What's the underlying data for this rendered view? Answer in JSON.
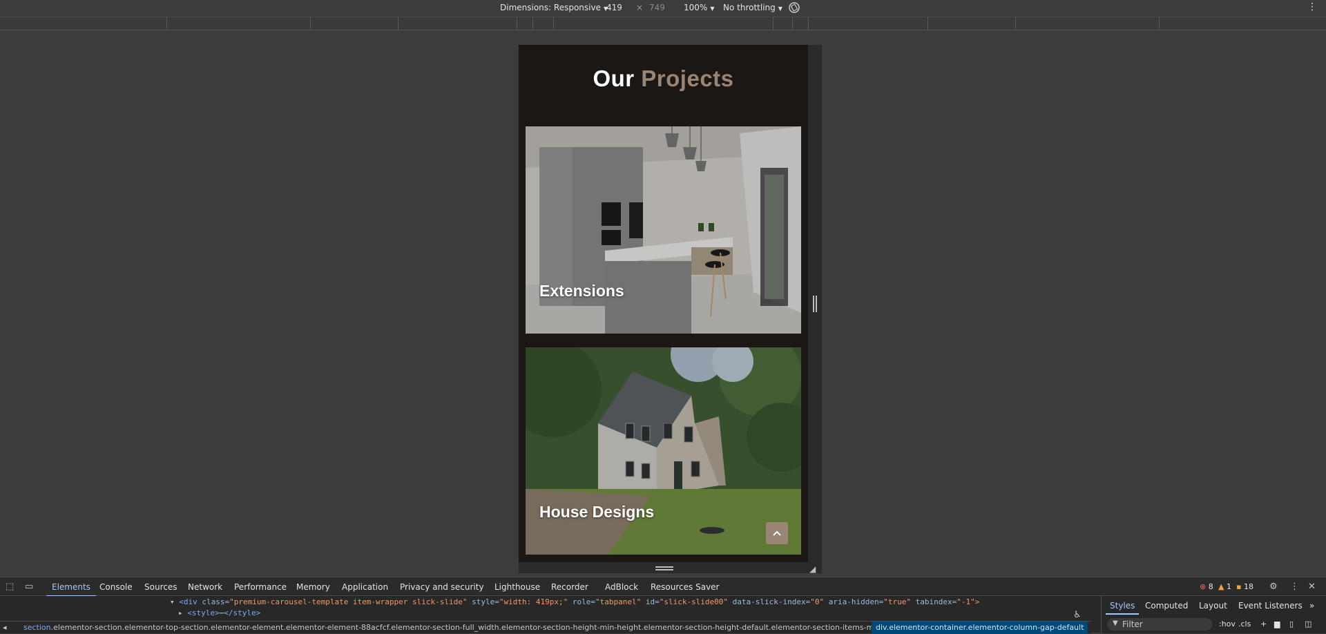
{
  "device_toolbar": {
    "dimensions_label": "Dimensions: Responsive",
    "width": "419",
    "times": "×",
    "height": "749",
    "zoom": "100%",
    "throttling": "No throttling",
    "rotate_icon": "rotate-icon",
    "more_icon": "more-vertical-icon"
  },
  "page": {
    "title_part1": "Our",
    "title_part2": "Projects",
    "title_accent_color": "#9a8474",
    "background_color": "#1b1714",
    "cards": [
      {
        "label": "Extensions",
        "image": "kitchen-interior"
      },
      {
        "label": "House Designs",
        "image": "house-exterior"
      }
    ],
    "scroll_top_icon": "chevron-up-icon"
  },
  "devtools": {
    "tabs": [
      "Elements",
      "Console",
      "Sources",
      "Network",
      "Performance",
      "Memory",
      "Application",
      "Privacy and security",
      "Lighthouse",
      "Recorder",
      "AdBlock",
      "Resources Saver"
    ],
    "active_tab": "Elements",
    "errors": "8",
    "warnings": "1",
    "issues": "18",
    "dom": {
      "line1_tag_open": "<div",
      "line1_class_attr": "class=",
      "line1_class_val": "\"premium-carousel-template item-wrapper slick-slide\"",
      "line1_style_attr": "style=",
      "line1_style_val": "\"width: 419px;\"",
      "line1_role_attr": "role=",
      "line1_role_val": "\"tabpanel\"",
      "line1_id_attr": "id=",
      "line1_id_val": "\"slick-slide00\"",
      "line1_index_attr": "data-slick-index=",
      "line1_index_val": "\"0\"",
      "line1_hidden_attr": "aria-hidden=",
      "line1_hidden_val": "\"true\"",
      "line1_tabindex_attr": "tabindex=",
      "line1_tabindex_val": "\"-1\">",
      "line2_open": "<style>",
      "line2_ellipsis": "⋯",
      "line2_close": "</style>"
    },
    "breadcrumb_el": "section",
    "breadcrumb_rest": ".elementor-section.elementor-top-section.elementor-element.elementor-element-88acfcf.elementor-section-full_width.elementor-section-height-min-height.elementor-section-height-default.elementor-section-items-middle",
    "breadcrumb_active_el": "div",
    "breadcrumb_active_rest": ".elementor-container.elementor-column-gap-default",
    "styles_tabs": [
      "Styles",
      "Computed",
      "Layout",
      "Event Listeners"
    ],
    "filter_placeholder": "Filter",
    "hov": ":hov",
    "cls": ".cls"
  }
}
